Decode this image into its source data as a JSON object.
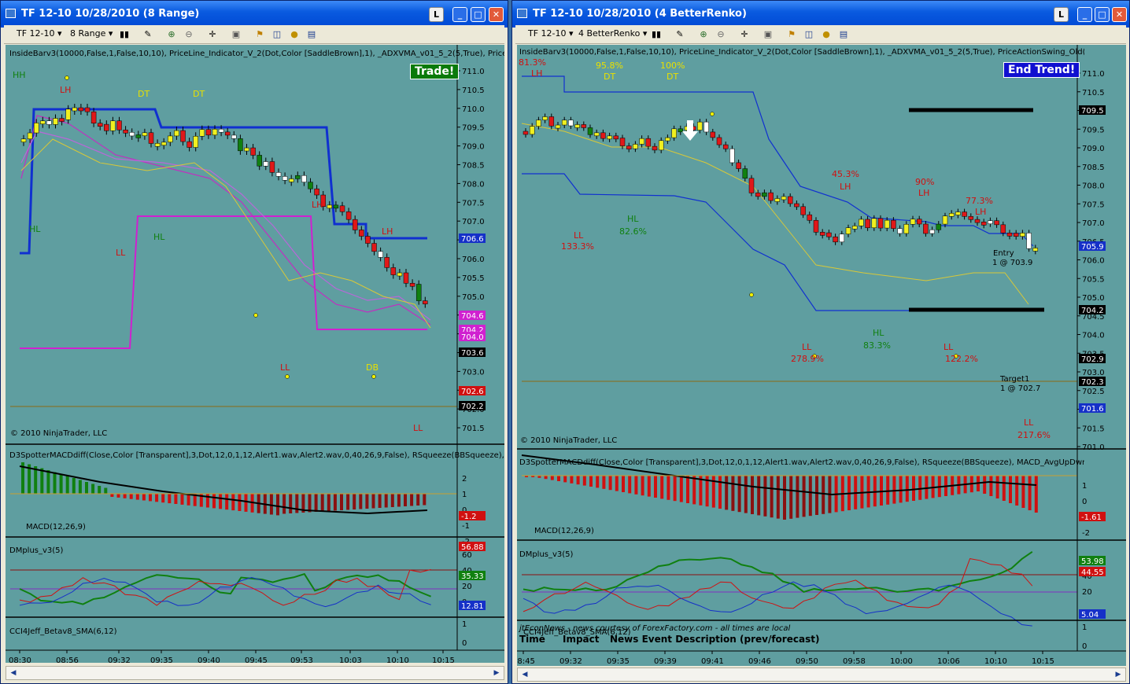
{
  "left": {
    "title": "TF 12-10  10/28/2010 (8 Range)",
    "toolbar": {
      "instrument": "TF 12-10",
      "period": "8 Range"
    },
    "indicator_line": "InsideBarv3(10000,False,1,False,10,10),  PriceLine_Indicator_V_2(Dot,Color [SaddleBrown],1),  _ADXVMA_v01_5_2(5,True),  PriceA",
    "badge": "Trade!",
    "copyright": "© 2010 NinjaTrader, LLC",
    "macd_line": "D3SpotterMACDdiff(Close,Color [Transparent],3,Dot,12,0,1,12,Alert1.wav,Alert2.wav,0,40,26,9,False), RSqueeze(BBSqueeze),  MA",
    "macd_label": "MACD(12,26,9)",
    "dmplus_label": "DMplus_v3(5)",
    "cci_label": "CCI4Jeff_Betav8_SMA(6,12)",
    "price_ticks": [
      "711.0",
      "710.5",
      "710.0",
      "709.5",
      "709.0",
      "708.5",
      "708.0",
      "707.5",
      "707.0",
      "706.5",
      "706.0",
      "705.5",
      "705.0",
      "704.5",
      "704.0",
      "703.5",
      "703.0",
      "702.5",
      "702.0",
      "701.5"
    ],
    "price_labels": [
      {
        "text": "706.6",
        "color": "#1530c8"
      },
      {
        "text": "704.6",
        "color": "#d020d0"
      },
      {
        "text": "704.2",
        "color": "#d020d0"
      },
      {
        "text": "704.0",
        "color": "#d020d0"
      },
      {
        "text": "703.6",
        "color": "#000000"
      },
      {
        "text": "702.6",
        "color": "#d01010"
      },
      {
        "text": "702.2",
        "color": "#000000"
      }
    ],
    "macd_ticks": [
      "2",
      "1",
      "0",
      "-1",
      "-2"
    ],
    "macd_label_vals": [
      {
        "text": "-1.2",
        "color": "#d01010"
      }
    ],
    "dm_ticks": [
      "60",
      "40",
      "20",
      "0"
    ],
    "dm_labels": [
      {
        "text": "56.88",
        "color": "#d01010"
      },
      {
        "text": "35.33",
        "color": "#108010"
      },
      {
        "text": "12.81",
        "color": "#1530c8"
      }
    ],
    "cci_ticks": [
      "1",
      "0"
    ],
    "time_ticks": [
      "08:30",
      "08:56",
      "09:32",
      "09:35",
      "09:40",
      "09:45",
      "09:53",
      "10:03",
      "10:10",
      "10:15"
    ],
    "annotations": [
      {
        "t": "HH",
        "c": "#108010"
      },
      {
        "t": "LH",
        "c": "#d01010"
      },
      {
        "t": "DT",
        "c": "#e8e000"
      },
      {
        "t": "DT",
        "c": "#e8e000"
      },
      {
        "t": "HL",
        "c": "#108010"
      },
      {
        "t": "HL",
        "c": "#108010"
      },
      {
        "t": "LL",
        "c": "#d01010"
      },
      {
        "t": "LH",
        "c": "#d01010"
      },
      {
        "t": "LH",
        "c": "#d01010"
      },
      {
        "t": "LL",
        "c": "#d01010"
      },
      {
        "t": "DB",
        "c": "#e8e000"
      },
      {
        "t": "LL",
        "c": "#d01010"
      }
    ]
  },
  "right": {
    "title": "TF 12-10  10/28/2010 (4 BetterRenko)",
    "toolbar": {
      "instrument": "TF 12-10",
      "period": "4 BetterRenko"
    },
    "indicator_line": "InsideBarv3(10000,False,1,False,10,10),  PriceLine_Indicator_V_2(Dot,Color [SaddleBrown],1),  _ADXVMA_v01_5_2(5,True),  PriceActionSwing_Old(Standard,4",
    "badge": "End Trend!",
    "copyright": "© 2010 NinjaTrader, LLC",
    "macd_line": "D3SpotterMACDdiff(Close,Color [Transparent],3,Dot,12,0,1,12,Alert1.wav,Alert2.wav,0,40,26,9,False), RSqueeze(BBSqueeze),  MACD_AvgUpDwn(8,17,9)",
    "macd_label": "MACD(12,26,9)",
    "dmplus_label": "DMplus_v3(5)",
    "cci_label": "CCI4Jeff_Betav8_SMA(6,12)",
    "news_header": "jtEconNews - news courtesy of ForexFactory.com - all times are local",
    "news_cols": [
      "Time",
      "Impact",
      "News Event Description (prev/forecast)"
    ],
    "entry_text": "Entry",
    "entry_val": "1 @ 703.9",
    "target_text": "Target1",
    "target_val": "1 @ 702.7",
    "price_ticks": [
      "711.0",
      "710.5",
      "710.0",
      "709.5",
      "709.0",
      "708.5",
      "708.0",
      "707.5",
      "707.0",
      "706.5",
      "706.0",
      "705.5",
      "705.0",
      "704.5",
      "704.0",
      "703.5",
      "703.0",
      "702.5",
      "702.0",
      "701.5",
      "701.0"
    ],
    "price_labels": [
      {
        "text": "709.5",
        "color": "#000000"
      },
      {
        "text": "705.9",
        "color": "#1530c8"
      },
      {
        "text": "704.2",
        "color": "#000000"
      },
      {
        "text": "702.9",
        "color": "#000000"
      },
      {
        "text": "702.3",
        "color": "#000000"
      },
      {
        "text": "701.6",
        "color": "#1530c8"
      }
    ],
    "macd_ticks": [
      "1",
      "0",
      "-1",
      "-2"
    ],
    "macd_label_vals": [
      {
        "text": "-1.61",
        "color": "#d01010"
      }
    ],
    "dm_ticks": [
      "60",
      "40",
      "20"
    ],
    "dm_labels": [
      {
        "text": "53.98",
        "color": "#108010"
      },
      {
        "text": "44.55",
        "color": "#d01010"
      },
      {
        "text": "5.04",
        "color": "#1530c8"
      }
    ],
    "cci_ticks": [
      "1",
      "0"
    ],
    "time_ticks": [
      "08:45",
      "09:32",
      "09:35",
      "09:39",
      "09:41",
      "09:46",
      "09:50",
      "09:58",
      "10:00",
      "10:06",
      "10:10",
      "10:15"
    ],
    "annotations": [
      {
        "t": "81.3%",
        "c": "#d01010"
      },
      {
        "t": "LH",
        "c": "#d01010"
      },
      {
        "t": "95.8%",
        "c": "#e8e000"
      },
      {
        "t": "DT",
        "c": "#e8e000"
      },
      {
        "t": "100%",
        "c": "#e8e000"
      },
      {
        "t": "DT",
        "c": "#e8e000"
      },
      {
        "t": "45.3%",
        "c": "#d01010"
      },
      {
        "t": "LH",
        "c": "#d01010"
      },
      {
        "t": "90%",
        "c": "#d01010"
      },
      {
        "t": "LH",
        "c": "#d01010"
      },
      {
        "t": "77.3%",
        "c": "#d01010"
      },
      {
        "t": "LH",
        "c": "#d01010"
      },
      {
        "t": "HL",
        "c": "#108010"
      },
      {
        "t": "82.6%",
        "c": "#108010"
      },
      {
        "t": "LL",
        "c": "#d01010"
      },
      {
        "t": "133.3%",
        "c": "#d01010"
      },
      {
        "t": "HL",
        "c": "#108010"
      },
      {
        "t": "83.3%",
        "c": "#108010"
      },
      {
        "t": "LL",
        "c": "#d01010"
      },
      {
        "t": "278.9%",
        "c": "#d01010"
      },
      {
        "t": "LL",
        "c": "#d01010"
      },
      {
        "t": "122.2%",
        "c": "#d01010"
      },
      {
        "t": "LL",
        "c": "#d01010"
      },
      {
        "t": "217.6%",
        "c": "#d01010"
      }
    ]
  }
}
